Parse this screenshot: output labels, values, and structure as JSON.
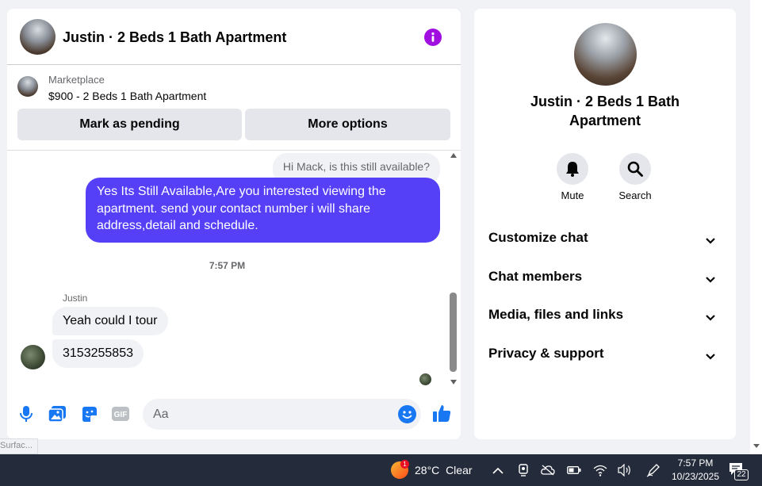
{
  "chat": {
    "header": {
      "title": "Justin · 2 Beds 1 Bath Apartment",
      "info_icon": "info-icon"
    },
    "listing": {
      "source": "Marketplace",
      "price_title": "$900 - 2 Beds 1 Bath Apartment"
    },
    "actions": {
      "mark_pending": "Mark as pending",
      "more_options": "More options"
    },
    "messages": {
      "previous_preview": "Hi Mack, is this still available?",
      "outgoing": "Yes Its Still Available,Are you interested viewing the apartment. send your contact number i will share address,detail and schedule.",
      "timestamp": "7:57 PM",
      "sender": "Justin",
      "incoming": [
        "Yeah could I tour",
        "3153255853"
      ]
    },
    "composer": {
      "placeholder": "Aa",
      "icons": [
        "microphone-icon",
        "photo-icon",
        "sticker-icon",
        "gif-icon",
        "emoji-icon",
        "thumbs-up-icon"
      ],
      "gif_label": "GIF"
    }
  },
  "info_panel": {
    "name": "Justin · 2 Beds 1 Bath Apartment",
    "actions": [
      {
        "label": "Mute",
        "icon": "bell-icon"
      },
      {
        "label": "Search",
        "icon": "search-icon"
      }
    ],
    "sections": [
      "Customize chat",
      "Chat members",
      "Media, files and links",
      "Privacy & support"
    ]
  },
  "status_hint": "Surfac...",
  "taskbar": {
    "weather": {
      "temp": "28°C",
      "condition": "Clear",
      "badge": "1"
    },
    "time": "7:57 PM",
    "date": "10/23/2025",
    "notification_count": "22"
  },
  "colors": {
    "accent": "#5540f7",
    "info_icon": "#a10ee0",
    "brand_blue": "#1877f2"
  }
}
